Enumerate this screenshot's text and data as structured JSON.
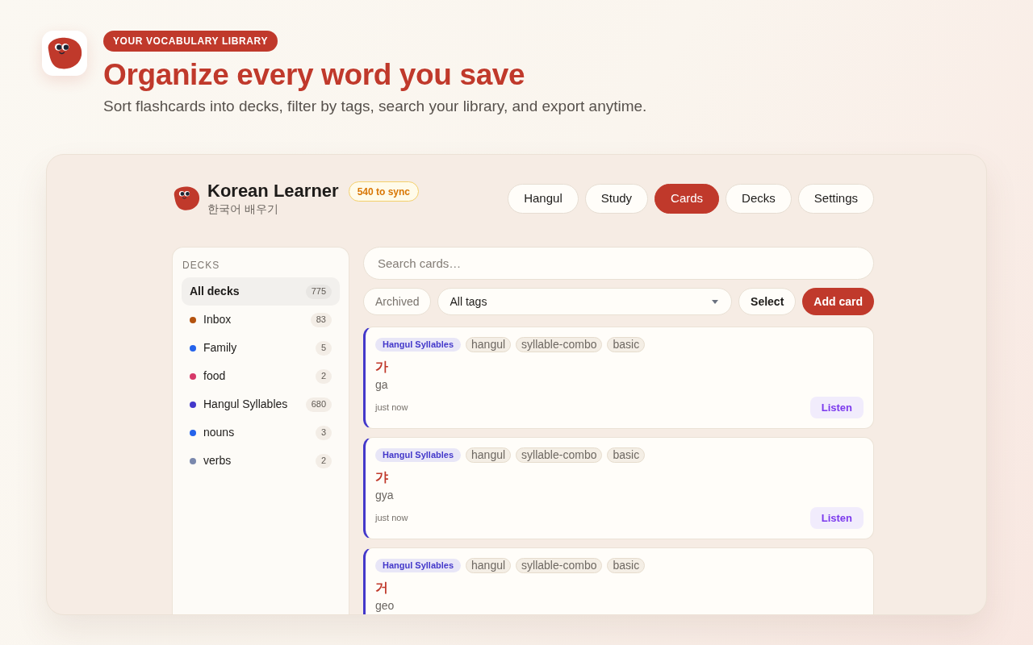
{
  "hero": {
    "badge": "YOUR VOCABULARY LIBRARY",
    "title": "Organize every word you save",
    "subtitle": "Sort flashcards into decks, filter by tags, search your library, and export anytime."
  },
  "app": {
    "brand": {
      "name": "Korean Learner",
      "subtitle": "한국어 배우기",
      "sync_badge": "540 to sync"
    },
    "tabs": [
      {
        "label": "Hangul",
        "selected": false
      },
      {
        "label": "Study",
        "selected": false
      },
      {
        "label": "Cards",
        "selected": true
      },
      {
        "label": "Decks",
        "selected": false
      },
      {
        "label": "Settings",
        "selected": false
      }
    ],
    "sidebar": {
      "heading": "DECKS",
      "items": [
        {
          "label": "All decks",
          "count": "775",
          "selected": true
        },
        {
          "label": "Inbox",
          "count": "83",
          "selected": false,
          "color": "#b4530f"
        },
        {
          "label": "Family",
          "count": "5",
          "selected": false,
          "color": "#2563eb"
        },
        {
          "label": "food",
          "count": "2",
          "selected": false,
          "color": "#d63868"
        },
        {
          "label": "Hangul Syllables",
          "count": "680",
          "selected": false,
          "color": "#4338ca"
        },
        {
          "label": "nouns",
          "count": "3",
          "selected": false,
          "color": "#2563eb"
        },
        {
          "label": "verbs",
          "count": "2",
          "selected": false,
          "color": "#7a88ad"
        }
      ]
    },
    "search": {
      "placeholder": "Search cards…"
    },
    "filters": {
      "archived": {
        "label": "Archived",
        "on": false
      },
      "tag_select": {
        "value": "All tags"
      },
      "select_button": "Select",
      "add_button": "Add card"
    },
    "cards": [
      {
        "deck": "Hangul Syllables",
        "color": "#4338ca",
        "tags": [
          "hangul",
          "syllable-combo",
          "basic"
        ],
        "word": "가",
        "romanization": "ga",
        "time": "just now",
        "action": "Listen"
      },
      {
        "deck": "Hangul Syllables",
        "color": "#4338ca",
        "tags": [
          "hangul",
          "syllable-combo",
          "basic"
        ],
        "word": "갸",
        "romanization": "gya",
        "time": "just now",
        "action": "Listen"
      },
      {
        "deck": "Hangul Syllables",
        "color": "#4338ca",
        "tags": [
          "hangul",
          "syllable-combo",
          "basic"
        ],
        "word": "거",
        "romanization": "geo"
      }
    ]
  }
}
